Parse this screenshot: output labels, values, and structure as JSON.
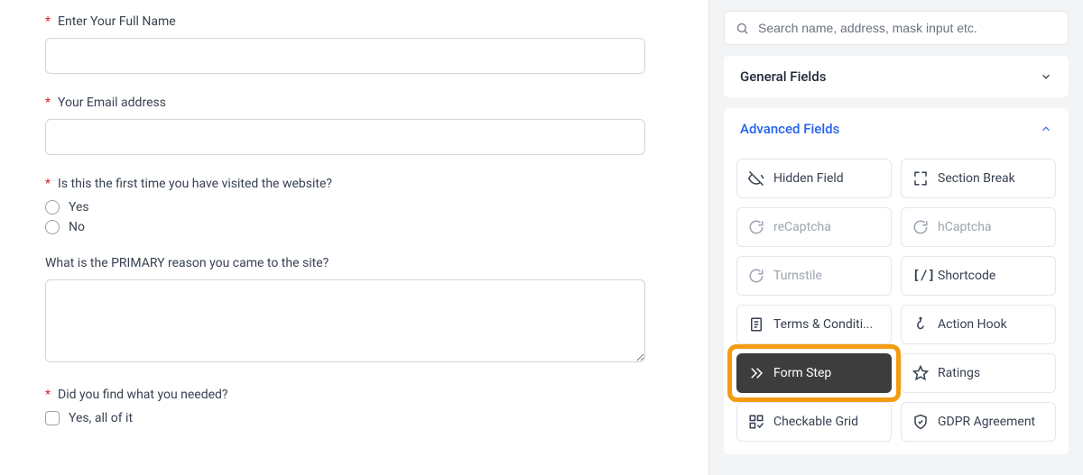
{
  "form": {
    "fields": {
      "name": {
        "label": "Enter Your Full Name",
        "required": true,
        "value": ""
      },
      "email": {
        "label": "Your Email address",
        "required": true,
        "value": ""
      },
      "first_time": {
        "label": "Is this the first time you have visited the website?",
        "required": true,
        "options": [
          "Yes",
          "No"
        ]
      },
      "primary_reason": {
        "label": "What is the PRIMARY reason you came to the site?",
        "required": false,
        "value": ""
      },
      "found": {
        "label": "Did you find what you needed?",
        "required": true,
        "options": [
          "Yes, all of it"
        ]
      }
    }
  },
  "sidebar": {
    "search": {
      "placeholder": "Search name, address, mask input etc."
    },
    "sections": {
      "general": {
        "title": "General Fields"
      },
      "advanced": {
        "title": "Advanced Fields",
        "items": [
          {
            "label": "Hidden Field",
            "icon": "hidden",
            "disabled": false
          },
          {
            "label": "Section Break",
            "icon": "section",
            "disabled": false
          },
          {
            "label": "reCaptcha",
            "icon": "recaptcha",
            "disabled": true
          },
          {
            "label": "hCaptcha",
            "icon": "hcaptcha",
            "disabled": true
          },
          {
            "label": "Turnstile",
            "icon": "turnstile",
            "disabled": true
          },
          {
            "label": "Shortcode",
            "icon": "shortcode",
            "disabled": false
          },
          {
            "label": "Terms & Conditi...",
            "icon": "terms",
            "disabled": false
          },
          {
            "label": "Action Hook",
            "icon": "hook",
            "disabled": false
          },
          {
            "label": "Form Step",
            "icon": "step",
            "disabled": false,
            "highlight": true
          },
          {
            "label": "Ratings",
            "icon": "star",
            "disabled": false
          },
          {
            "label": "Checkable Grid",
            "icon": "grid",
            "disabled": false
          },
          {
            "label": "GDPR Agreement",
            "icon": "shield",
            "disabled": false
          }
        ]
      }
    }
  }
}
